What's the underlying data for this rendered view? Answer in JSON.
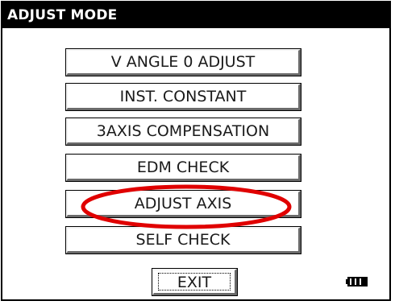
{
  "window": {
    "title": "ADJUST MODE"
  },
  "menu": {
    "items": [
      {
        "label": "V ANGLE 0 ADJUST"
      },
      {
        "label": "INST. CONSTANT"
      },
      {
        "label": "3AXIS COMPENSATION"
      },
      {
        "label": "EDM CHECK"
      },
      {
        "label": "ADJUST AXIS",
        "highlighted": true
      },
      {
        "label": "SELF CHECK"
      }
    ]
  },
  "footer": {
    "exit_label": "EXIT",
    "battery_icon": "battery-full-icon"
  },
  "colors": {
    "titlebar_bg": "#000000",
    "highlight": "#e00000"
  }
}
